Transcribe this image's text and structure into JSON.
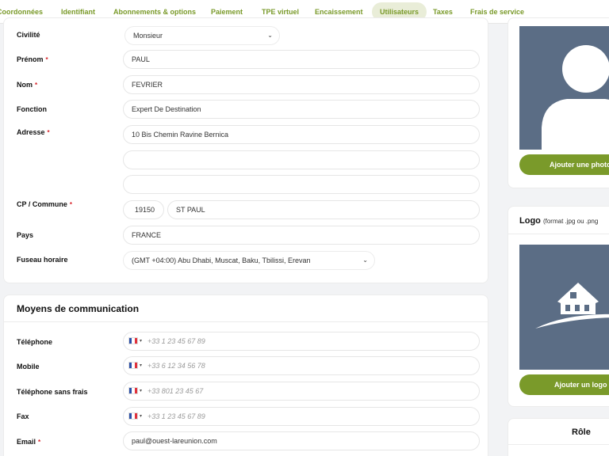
{
  "tabs": [
    {
      "label": "Coordonnées",
      "active": false
    },
    {
      "label": "Identifiant",
      "active": false
    },
    {
      "label": "Abonnements & options",
      "active": false
    },
    {
      "label": "Paiement",
      "active": false
    },
    {
      "label": "TPE virtuel",
      "active": false
    },
    {
      "label": "Encaissement",
      "active": false
    },
    {
      "label": "Utilisateurs",
      "active": true
    },
    {
      "label": "Taxes",
      "active": false
    },
    {
      "label": "Frais de service",
      "active": false
    }
  ],
  "form": {
    "civilite": {
      "label": "Civilité",
      "value": "Monsieur"
    },
    "prenom": {
      "label": "Prénom",
      "value": "PAUL"
    },
    "nom": {
      "label": "Nom",
      "value": "FEVRIER"
    },
    "fonction": {
      "label": "Fonction",
      "value": "Expert De Destination"
    },
    "adresse": {
      "label": "Adresse",
      "line1": "10 Bis Chemin Ravine Bernica",
      "line2": "",
      "line3": ""
    },
    "cp_commune": {
      "label": "CP / Commune",
      "cp": "19150",
      "commune": "ST PAUL"
    },
    "pays": {
      "label": "Pays",
      "value": "FRANCE"
    },
    "fuseau": {
      "label": "Fuseau horaire",
      "value": "(GMT +04:00) Abu Dhabi, Muscat, Baku, Tbilissi, Erevan"
    },
    "required_mark": "*"
  },
  "communication": {
    "title": "Moyens de communication",
    "telephone": {
      "label": "Téléphone",
      "placeholder": "+33 1 23 45 67 89"
    },
    "mobile": {
      "label": "Mobile",
      "placeholder": "+33 6 12 34 56 78"
    },
    "sans_frais": {
      "label": "Téléphone sans frais",
      "placeholder": "+33 801 23 45 67"
    },
    "fax": {
      "label": "Fax",
      "placeholder": "+33 1 23 45 67 89"
    },
    "email": {
      "label": "Email",
      "value": "paul@ouest-lareunion.com"
    }
  },
  "photo": {
    "button": "Ajouter une photo"
  },
  "logo": {
    "title": "Logo",
    "hint": "(format .jpg ou .png",
    "button": "Ajouter un logo"
  },
  "role": {
    "title": "Rôle"
  },
  "colors": {
    "accent": "#7a9a2a",
    "placeholder_bg": "#5b6d85",
    "required": "#d8232a"
  }
}
